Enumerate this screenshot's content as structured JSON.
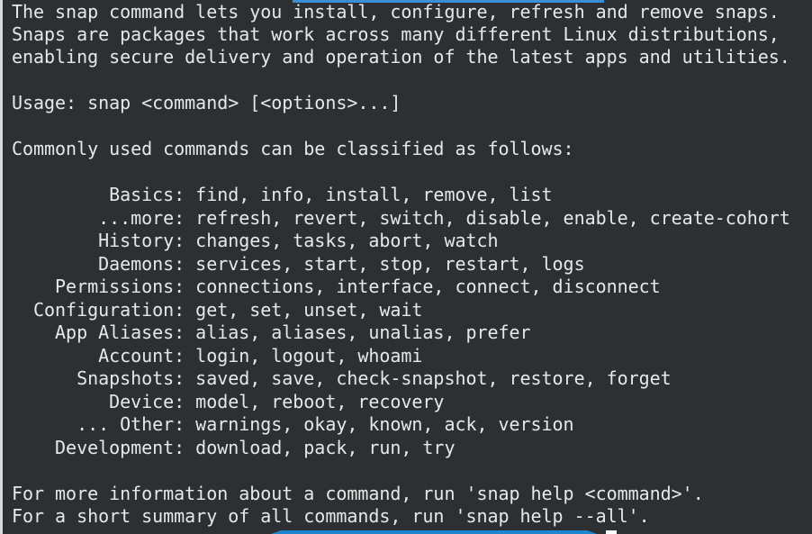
{
  "terminal": {
    "lines": [
      "The snap command lets you install, configure, refresh and remove snaps.",
      "Snaps are packages that work across many different Linux distributions,",
      "enabling secure delivery and operation of the latest apps and utilities.",
      "",
      "Usage: snap <command> [<options>...]",
      "",
      "Commonly used commands can be classified as follows:",
      "",
      "         Basics: find, info, install, remove, list",
      "        ...more: refresh, revert, switch, disable, enable, create-cohort",
      "        History: changes, tasks, abort, watch",
      "        Daemons: services, start, stop, restart, logs",
      "    Permissions: connections, interface, connect, disconnect",
      "  Configuration: get, set, unset, wait",
      "    App Aliases: alias, aliases, unalias, prefer",
      "        Account: login, logout, whoami",
      "      Snapshots: saved, save, check-snapshot, restore, forget",
      "         Device: model, reboot, recovery",
      "      ... Other: warnings, okay, known, ack, version",
      "    Development: download, pack, run, try",
      "",
      "For more information about a command, run 'snap help <command>'.",
      "For a short summary of all commands, run 'snap help --all'."
    ],
    "partial_line": "(lower line partially visible)"
  }
}
